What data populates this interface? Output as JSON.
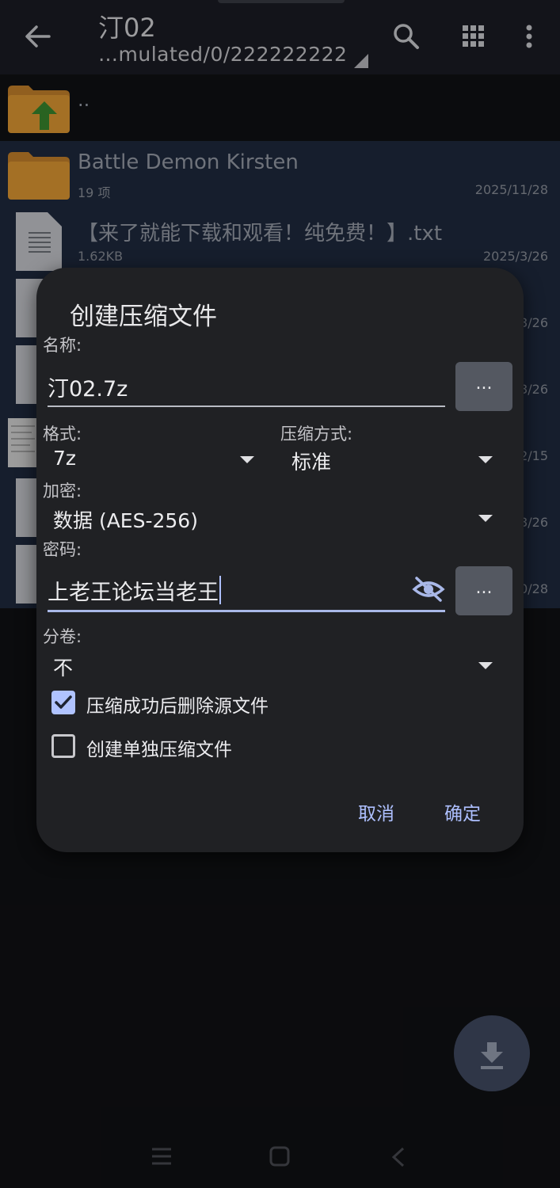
{
  "app": {
    "title": "汀02",
    "path": "…mulated/0/222222222",
    "icons": {
      "back": "arrow-back-icon",
      "search": "search-icon",
      "grid": "grid-view-icon",
      "more": "more-vertical-icon"
    }
  },
  "file_list": {
    "up_row": {
      "name": ".."
    },
    "items": [
      {
        "name": "Battle Demon Kirsten",
        "meta": "19 项",
        "date": "2025/11/28",
        "type": "folder"
      },
      {
        "name": "【来了就能下载和观看！纯免费！】.txt",
        "meta": "1.62KB",
        "date": "2025/3/26",
        "type": "text"
      },
      {
        "name": "",
        "meta": "",
        "date": "3/26",
        "type": "text"
      },
      {
        "name": "",
        "meta": "",
        "date": "3/26",
        "type": "text"
      },
      {
        "name": "",
        "meta": "",
        "date": "2/15",
        "type": "image"
      },
      {
        "name": "",
        "meta": "",
        "date": "3/26",
        "type": "text"
      },
      {
        "name": "",
        "meta": "",
        "date": "0/28",
        "type": "text"
      }
    ]
  },
  "dialog": {
    "title": "创建压缩文件",
    "name_label": "名称:",
    "name_value": "汀02.7z",
    "browse_label": "...",
    "format_label": "格式:",
    "format_value": "7z",
    "method_label": "压缩方式:",
    "method_value": "标准",
    "encrypt_label": "加密:",
    "encrypt_value": "数据 (AES-256)",
    "password_label": "密码:",
    "password_value": "上老王论坛当老王",
    "password_more_label": "...",
    "split_label": "分卷:",
    "split_value": "不",
    "delete_source": {
      "label": "压缩成功后删除源文件",
      "checked": true
    },
    "separate_archives": {
      "label": "创建单独压缩文件",
      "checked": false
    },
    "cancel_label": "取消",
    "ok_label": "确定"
  },
  "colors": {
    "accent": "#aec0ff",
    "dialog_bg": "#202124",
    "selection_bg": "#1f2a3f"
  }
}
